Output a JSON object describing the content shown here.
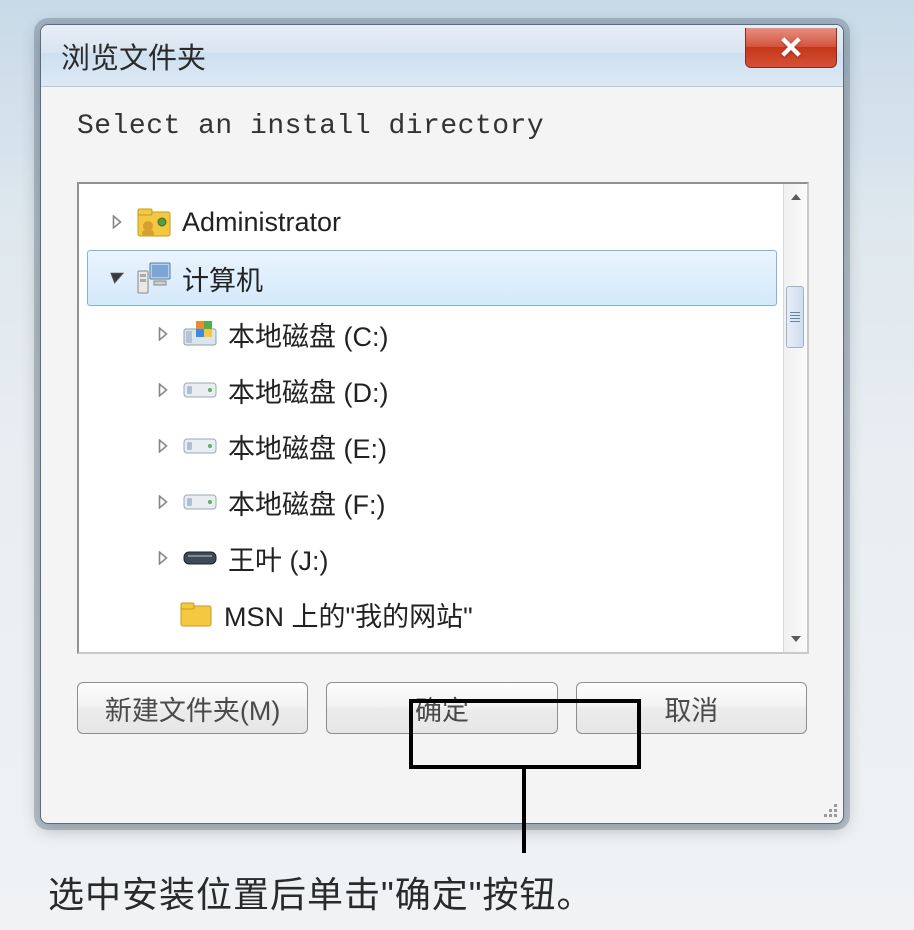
{
  "dialog": {
    "title": "浏览文件夹",
    "instruction": "Select an install directory",
    "buttons": {
      "new_folder": "新建文件夹(M)",
      "ok": "确定",
      "cancel": "取消"
    }
  },
  "tree": {
    "items": [
      {
        "label": "Administrator",
        "icon": "user-folder",
        "depth": 0,
        "expand": "right",
        "selected": false
      },
      {
        "label": "计算机",
        "icon": "computer",
        "depth": 0,
        "expand": "down",
        "selected": true
      },
      {
        "label": "本地磁盘 (C:)",
        "icon": "drive-win",
        "depth": 1,
        "expand": "right",
        "selected": false
      },
      {
        "label": "本地磁盘 (D:)",
        "icon": "drive",
        "depth": 1,
        "expand": "right",
        "selected": false
      },
      {
        "label": "本地磁盘 (E:)",
        "icon": "drive",
        "depth": 1,
        "expand": "right",
        "selected": false
      },
      {
        "label": "本地磁盘 (F:)",
        "icon": "drive",
        "depth": 1,
        "expand": "right",
        "selected": false
      },
      {
        "label": "王叶 (J:)",
        "icon": "scanner",
        "depth": 1,
        "expand": "right",
        "selected": false
      },
      {
        "label": "MSN 上的\"我的网站\"",
        "icon": "folder",
        "depth": 1,
        "expand": "none",
        "selected": false
      }
    ]
  },
  "caption": "选中安装位置后单击\"确定\"按钮。"
}
